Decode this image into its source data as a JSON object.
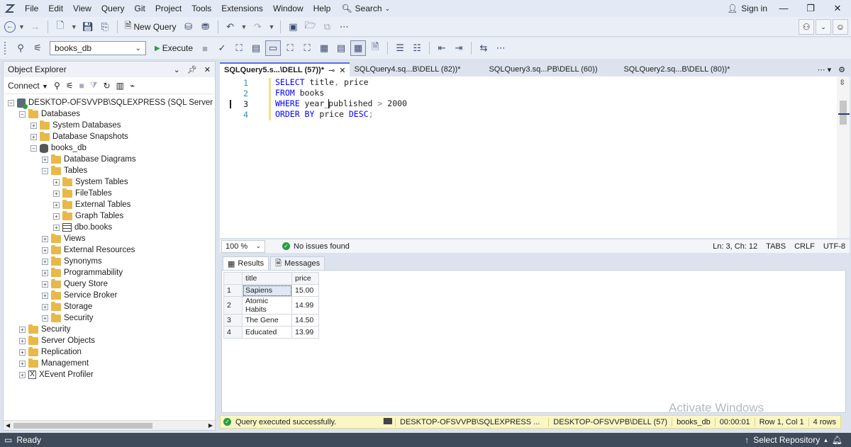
{
  "menu": [
    "File",
    "Edit",
    "View",
    "Query",
    "Git",
    "Project",
    "Tools",
    "Extensions",
    "Window",
    "Help"
  ],
  "search_label": "Search",
  "signin_label": "Sign in",
  "toolbar": {
    "new_query": "New Query",
    "execute": "Execute",
    "database": "books_db"
  },
  "object_explorer": {
    "title": "Object Explorer",
    "connect": "Connect",
    "server": "DESKTOP-OFSVVPB\\SQLEXPRESS (SQL Server 17.0.1000 -",
    "nodes": {
      "databases": "Databases",
      "system_databases": "System Databases",
      "database_snapshots": "Database Snapshots",
      "books_db": "books_db",
      "database_diagrams": "Database Diagrams",
      "tables": "Tables",
      "system_tables": "System Tables",
      "file_tables": "FileTables",
      "external_tables": "External Tables",
      "graph_tables": "Graph Tables",
      "dbo_books": "dbo.books",
      "views": "Views",
      "external_resources": "External Resources",
      "synonyms": "Synonyms",
      "programmability": "Programmability",
      "query_store": "Query Store",
      "service_broker": "Service Broker",
      "storage": "Storage",
      "db_security": "Security",
      "security": "Security",
      "server_objects": "Server Objects",
      "replication": "Replication",
      "management": "Management",
      "xevent_profiler": "XEvent Profiler"
    }
  },
  "tabs": [
    {
      "label": "SQLQuery5.s...\\DELL (57))*",
      "active": true
    },
    {
      "label": "SQLQuery4.sq...B\\DELL (82))*"
    },
    {
      "label": "SQLQuery3.sq...PB\\DELL (60))"
    },
    {
      "label": "SQLQuery2.sq...B\\DELL (80))*"
    }
  ],
  "editor": {
    "line_numbers": [
      "1",
      "2",
      "3",
      "4"
    ],
    "lines": [
      {
        "kw1": "SELECT",
        "id1": " title",
        "op1": ",",
        "id2": " price"
      },
      {
        "kw1": "FROM",
        "id1": " books"
      },
      {
        "kw1": "WHERE",
        "id1a": " year_",
        "id1b": "published",
        "op1": " > ",
        "id2": "2000"
      },
      {
        "kw1": "ORDER BY",
        "id1": " price ",
        "kw2": "DESC",
        "op1": ";"
      }
    ]
  },
  "editor_status": {
    "zoom": "100 %",
    "issues": "No issues found",
    "position": "Ln: 3, Ch: 12",
    "tabs": "TABS",
    "eol": "CRLF",
    "encoding": "UTF-8"
  },
  "result_tabs": {
    "results": "Results",
    "messages": "Messages"
  },
  "results": {
    "columns": [
      "title",
      "price"
    ],
    "rows": [
      {
        "n": "1",
        "title": "Sapiens",
        "price": "15.00"
      },
      {
        "n": "2",
        "title": "Atomic Habits",
        "price": "14.99"
      },
      {
        "n": "3",
        "title": "The Gene",
        "price": "14.50"
      },
      {
        "n": "4",
        "title": "Educated",
        "price": "13.99"
      }
    ]
  },
  "query_status": {
    "message": "Query executed successfully.",
    "server": "DESKTOP-OFSVVPB\\SQLEXPRESS ...",
    "user": "DESKTOP-OFSVVPB\\DELL (57)",
    "database": "books_db",
    "time": "00:00:01",
    "position": "Row 1, Col 1",
    "rows": "4 rows"
  },
  "watermark": "Activate Windows",
  "app_status": {
    "ready": "Ready",
    "repo": "Select Repository"
  },
  "colors": {
    "accent": "#5b6ee1",
    "keyword": "#0000ff",
    "success": "#2a9d40",
    "status_bar": "#3f4a5b"
  }
}
